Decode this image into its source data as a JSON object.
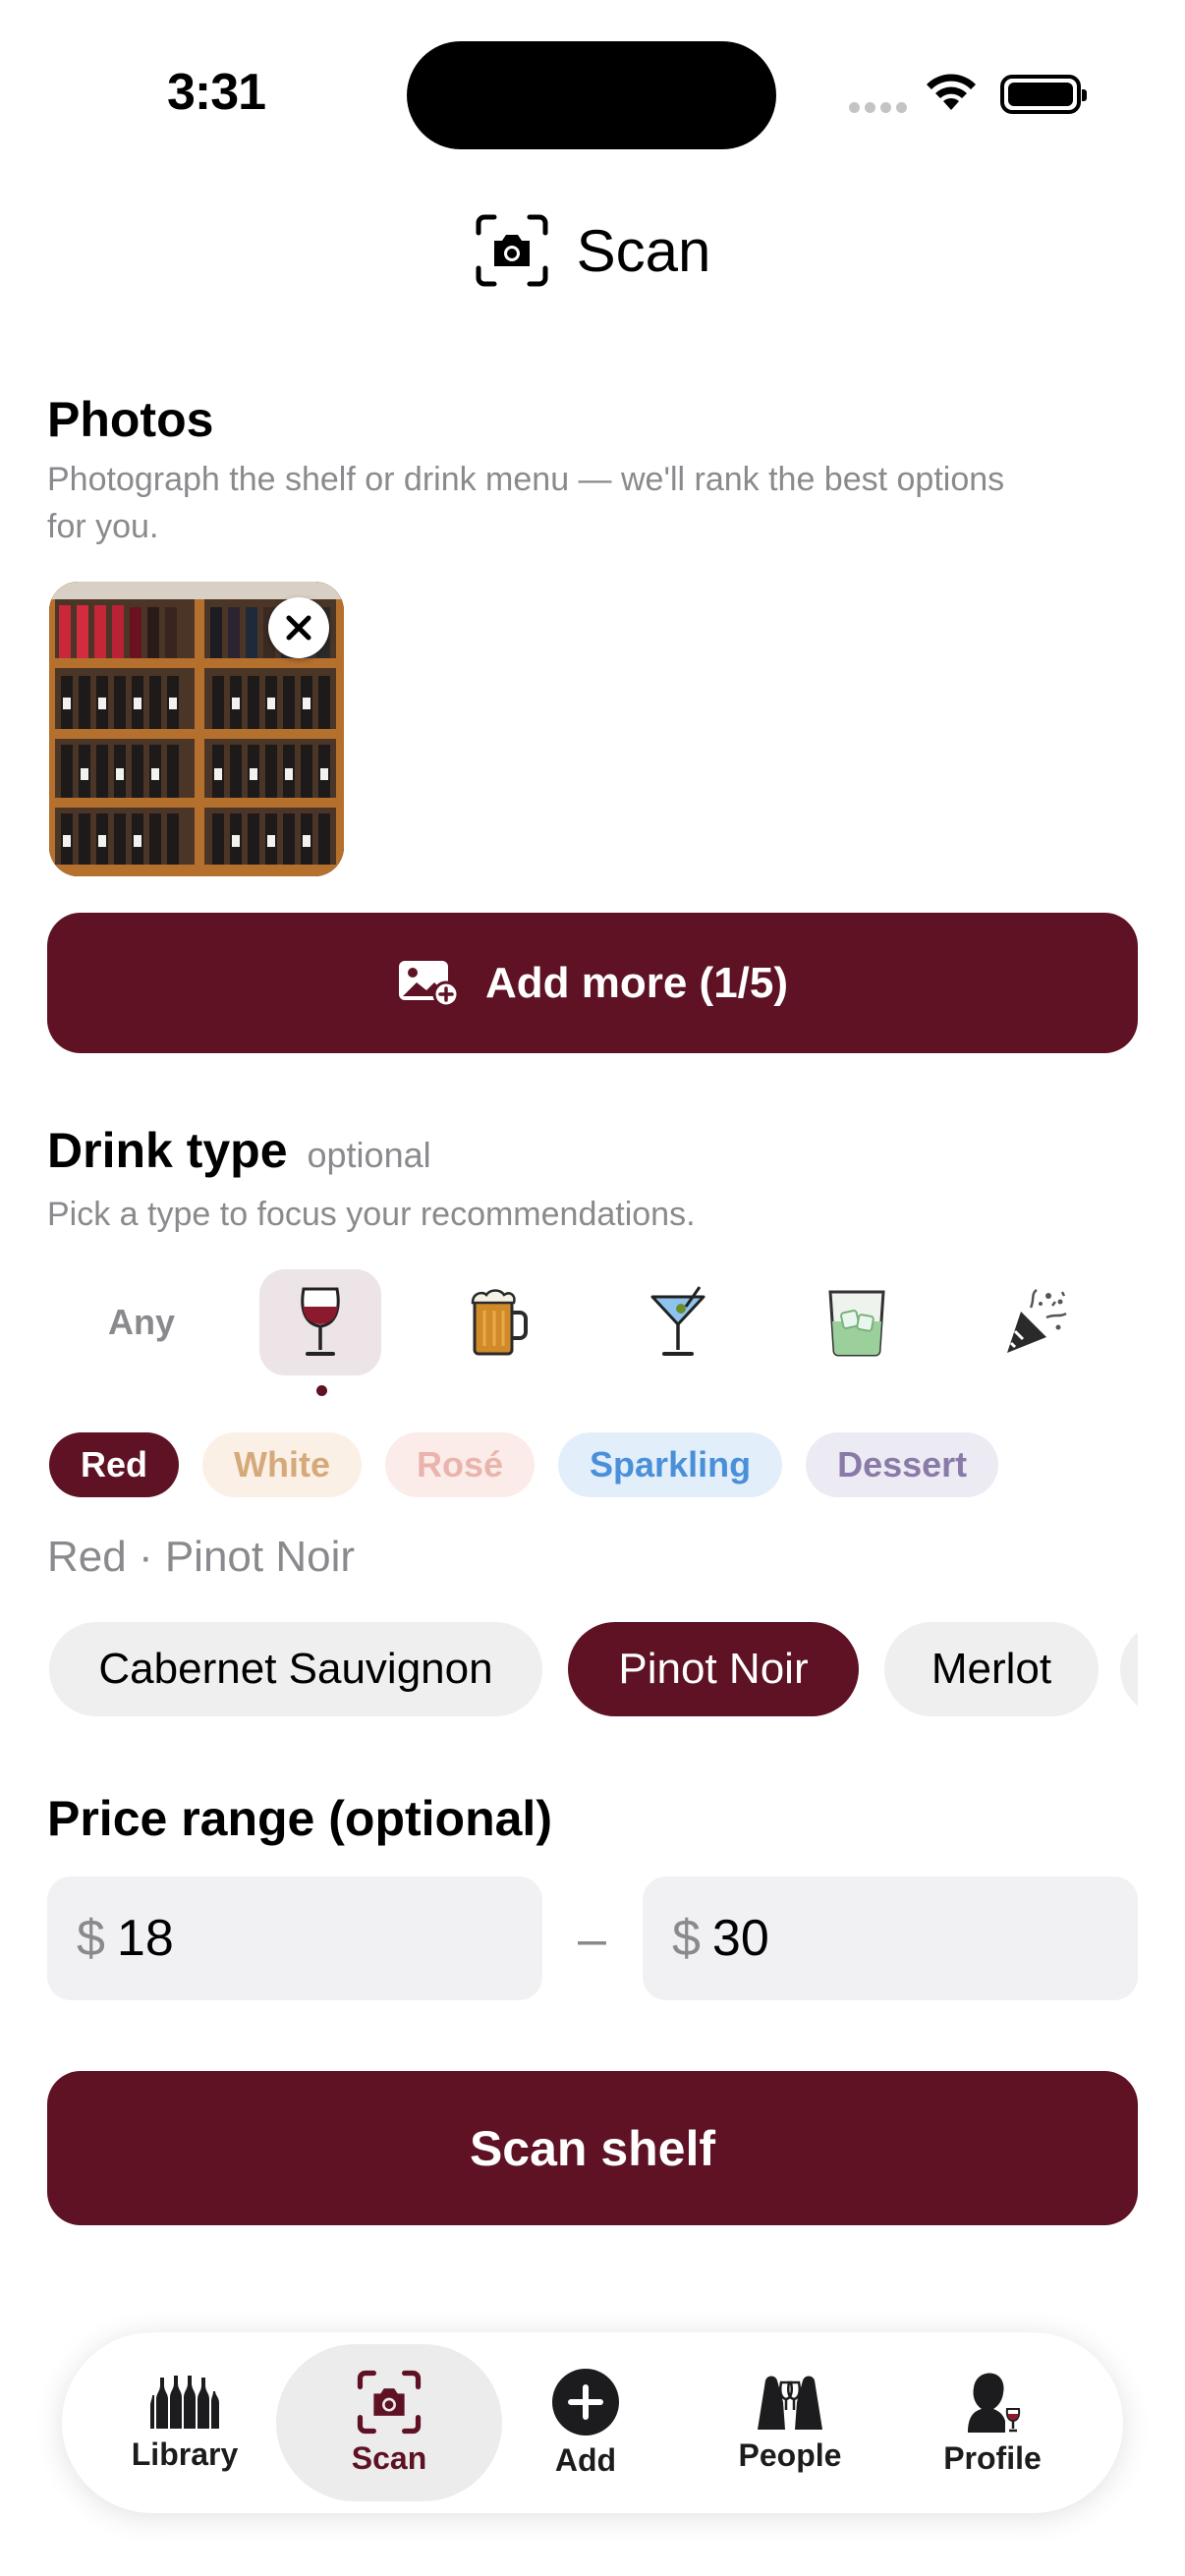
{
  "status": {
    "time": "3:31"
  },
  "nav": {
    "title": "Scan",
    "icon": "camera-viewfinder-icon"
  },
  "photos": {
    "title": "Photos",
    "subtitle_line1": "Photograph the shelf or drink menu — we'll rank the best options",
    "subtitle_line2": "for you."
  },
  "add_more": {
    "label": "Add more (1/5)",
    "icon": "photo-add-icon"
  },
  "drink_type": {
    "title": "Drink type",
    "optional": "optional",
    "subtitle": "Pick a type to focus your recommendations.",
    "types": [
      {
        "label": "Any",
        "icon": null
      },
      {
        "label": "",
        "icon": "wine-glass-icon",
        "selected": true
      },
      {
        "label": "",
        "icon": "beer-mug-icon"
      },
      {
        "label": "",
        "icon": "martini-glass-icon"
      },
      {
        "label": "",
        "icon": "whiskey-glass-icon"
      },
      {
        "label": "",
        "icon": "party-popper-icon"
      }
    ]
  },
  "wine_styles": [
    {
      "label": "Red",
      "active": true,
      "bg": "#5e1224",
      "color": "#ffffff"
    },
    {
      "label": "White",
      "bg": "#fbf0e6",
      "color": "#d6a97a"
    },
    {
      "label": "Rosé",
      "bg": "#fbece9",
      "color": "#e9b4ad"
    },
    {
      "label": "Sparkling",
      "bg": "#e2effb",
      "color": "#4a90d9"
    },
    {
      "label": "Dessert",
      "bg": "#eceaf3",
      "color": "#8a7aa8"
    }
  ],
  "selection_label": "Red · Pinot Noir",
  "grapes": [
    "Cabernet Sauvignon",
    "Pinot Noir",
    "Merlot"
  ],
  "price": {
    "title": "Price range (optional)",
    "currency": "$",
    "min": "18",
    "max": "30",
    "dash": "–"
  },
  "scan_button": "Scan shelf",
  "tabs": [
    {
      "label": "Library",
      "icon": "wine-bottles-icon"
    },
    {
      "label": "Scan",
      "icon": "camera-viewfinder-icon",
      "active": true
    },
    {
      "label": "Add",
      "icon": "plus-circle-icon"
    },
    {
      "label": "People",
      "icon": "people-toast-icon"
    },
    {
      "label": "Profile",
      "icon": "profile-wine-icon"
    }
  ],
  "colors": {
    "accent": "#5e1224",
    "muted": "#8a8a8e",
    "field": "#f1f1f4"
  }
}
